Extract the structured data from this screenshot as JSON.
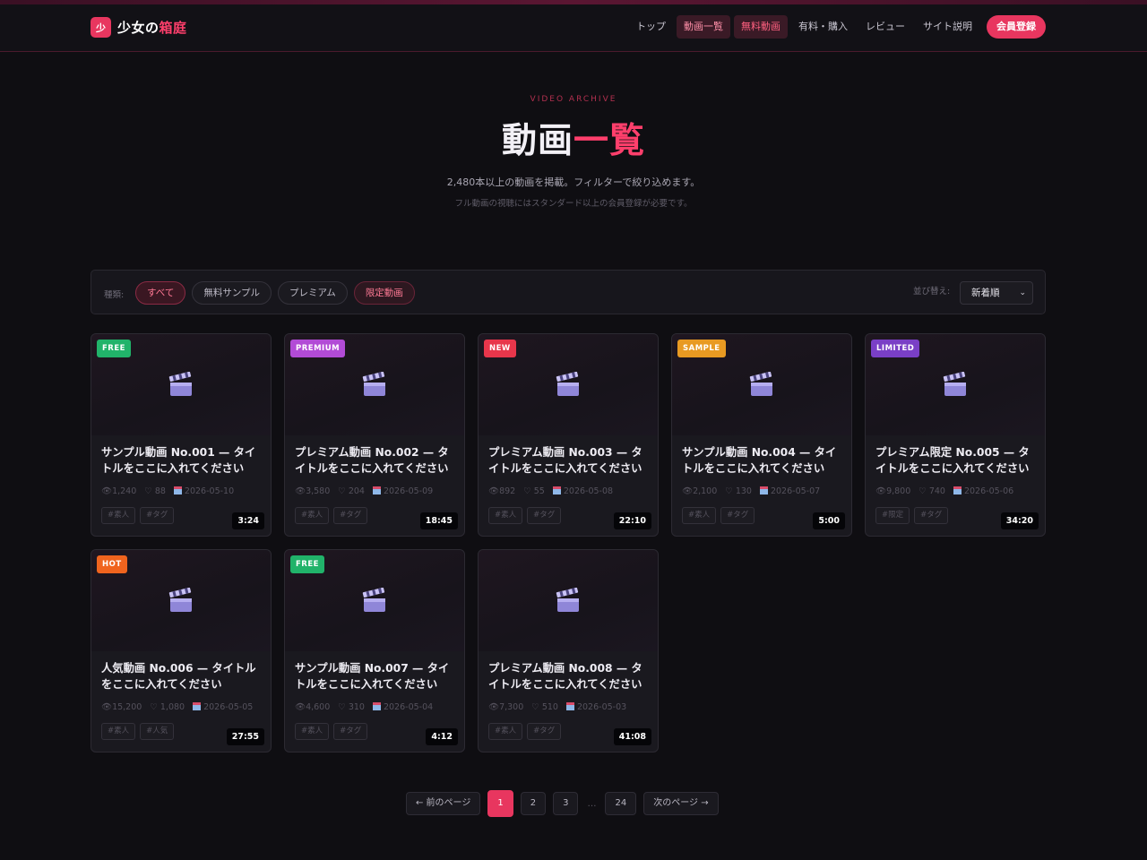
{
  "header": {
    "logo_mark": "少",
    "logo_main": "少女の",
    "logo_accent": "箱庭",
    "nav": [
      {
        "label": "トップ"
      },
      {
        "label": "動画一覧"
      },
      {
        "label": "無料動画"
      },
      {
        "label": "有料・購入"
      },
      {
        "label": "レビュー"
      },
      {
        "label": "サイト説明"
      },
      {
        "label": "会員登録"
      }
    ]
  },
  "hero": {
    "eyebrow": "VIDEO ARCHIVE",
    "title_main": "動画",
    "title_accent": "一覧",
    "description": "2,480本以上の動画を掲載。フィルターで絞り込めます。",
    "sub": "フル動画の視聴にはスタンダード以上の会員登録が必要です。"
  },
  "filter": {
    "label": "種類:",
    "chips": [
      "すべて",
      "無料サンプル",
      "プレミアム",
      "限定動画"
    ],
    "sort_label": "並び替え:",
    "sort_value": "新着順"
  },
  "colors": {
    "accent": "#e8365f",
    "free": "#21b36a",
    "premium": "#b24bd6",
    "new": "#e8364b",
    "sample": "#e89a22",
    "limited": "#7a3fc6",
    "hot": "#f0641e"
  },
  "videos": [
    {
      "badge": "FREE",
      "title": "サンプル動画 No.001 — タイトルをここに入れてください",
      "views": "1,240",
      "likes": "88",
      "date": "2026-05-10",
      "tags": [
        "#素人",
        "#タグ"
      ],
      "duration": "3:24"
    },
    {
      "badge": "PREMIUM",
      "title": "プレミアム動画 No.002 — タイトルをここに入れてください",
      "views": "3,580",
      "likes": "204",
      "date": "2026-05-09",
      "tags": [
        "#素人",
        "#タグ"
      ],
      "duration": "18:45"
    },
    {
      "badge": "NEW",
      "title": "プレミアム動画 No.003 — タイトルをここに入れてください",
      "views": "892",
      "likes": "55",
      "date": "2026-05-08",
      "tags": [
        "#素人",
        "#タグ"
      ],
      "duration": "22:10"
    },
    {
      "badge": "SAMPLE",
      "title": "サンプル動画 No.004 — タイトルをここに入れてください",
      "views": "2,100",
      "likes": "130",
      "date": "2026-05-07",
      "tags": [
        "#素人",
        "#タグ"
      ],
      "duration": "5:00"
    },
    {
      "badge": "LIMITED",
      "title": "プレミアム限定 No.005 — タイトルをここに入れてください",
      "views": "9,800",
      "likes": "740",
      "date": "2026-05-06",
      "tags": [
        "#限定",
        "#タグ"
      ],
      "duration": "34:20"
    },
    {
      "badge": "HOT",
      "title": "人気動画 No.006 — タイトルをここに入れてください",
      "views": "15,200",
      "likes": "1,080",
      "date": "2026-05-05",
      "tags": [
        "#素人",
        "#人気"
      ],
      "duration": "27:55"
    },
    {
      "badge": "FREE",
      "title": "サンプル動画 No.007 — タイトルをここに入れてください",
      "views": "4,600",
      "likes": "310",
      "date": "2026-05-04",
      "tags": [
        "#素人",
        "#タグ"
      ],
      "duration": "4:12"
    },
    {
      "badge": "",
      "title": "プレミアム動画 No.008 — タイトルをここに入れてください",
      "views": "7,300",
      "likes": "510",
      "date": "2026-05-03",
      "tags": [
        "#素人",
        "#タグ"
      ],
      "duration": "41:08"
    }
  ],
  "pagination": {
    "prev": "← 前のページ",
    "pages": [
      "1",
      "2",
      "3"
    ],
    "dots": "…",
    "last": "24",
    "next": "次のページ →",
    "current": "1"
  }
}
